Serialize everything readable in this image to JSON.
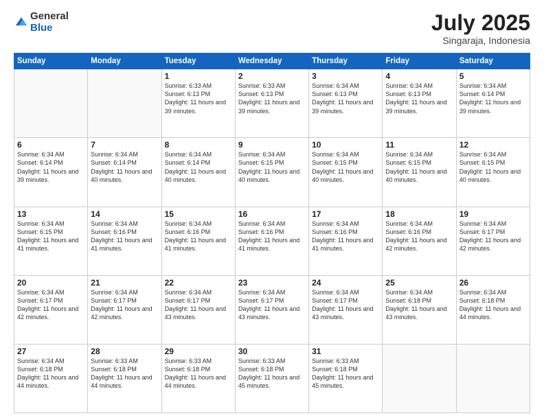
{
  "header": {
    "logo_general": "General",
    "logo_blue": "Blue",
    "month_year": "July 2025",
    "location": "Singaraja, Indonesia"
  },
  "days_of_week": [
    "Sunday",
    "Monday",
    "Tuesday",
    "Wednesday",
    "Thursday",
    "Friday",
    "Saturday"
  ],
  "weeks": [
    [
      {
        "day": "",
        "detail": ""
      },
      {
        "day": "",
        "detail": ""
      },
      {
        "day": "1",
        "detail": "Sunrise: 6:33 AM\nSunset: 6:13 PM\nDaylight: 11 hours\nand 39 minutes."
      },
      {
        "day": "2",
        "detail": "Sunrise: 6:33 AM\nSunset: 6:13 PM\nDaylight: 11 hours\nand 39 minutes."
      },
      {
        "day": "3",
        "detail": "Sunrise: 6:34 AM\nSunset: 6:13 PM\nDaylight: 11 hours\nand 39 minutes."
      },
      {
        "day": "4",
        "detail": "Sunrise: 6:34 AM\nSunset: 6:13 PM\nDaylight: 11 hours\nand 39 minutes."
      },
      {
        "day": "5",
        "detail": "Sunrise: 6:34 AM\nSunset: 6:14 PM\nDaylight: 11 hours\nand 39 minutes."
      }
    ],
    [
      {
        "day": "6",
        "detail": "Sunrise: 6:34 AM\nSunset: 6:14 PM\nDaylight: 11 hours\nand 39 minutes."
      },
      {
        "day": "7",
        "detail": "Sunrise: 6:34 AM\nSunset: 6:14 PM\nDaylight: 11 hours\nand 40 minutes."
      },
      {
        "day": "8",
        "detail": "Sunrise: 6:34 AM\nSunset: 6:14 PM\nDaylight: 11 hours\nand 40 minutes."
      },
      {
        "day": "9",
        "detail": "Sunrise: 6:34 AM\nSunset: 6:15 PM\nDaylight: 11 hours\nand 40 minutes."
      },
      {
        "day": "10",
        "detail": "Sunrise: 6:34 AM\nSunset: 6:15 PM\nDaylight: 11 hours\nand 40 minutes."
      },
      {
        "day": "11",
        "detail": "Sunrise: 6:34 AM\nSunset: 6:15 PM\nDaylight: 11 hours\nand 40 minutes."
      },
      {
        "day": "12",
        "detail": "Sunrise: 6:34 AM\nSunset: 6:15 PM\nDaylight: 11 hours\nand 40 minutes."
      }
    ],
    [
      {
        "day": "13",
        "detail": "Sunrise: 6:34 AM\nSunset: 6:15 PM\nDaylight: 11 hours\nand 41 minutes."
      },
      {
        "day": "14",
        "detail": "Sunrise: 6:34 AM\nSunset: 6:16 PM\nDaylight: 11 hours\nand 41 minutes."
      },
      {
        "day": "15",
        "detail": "Sunrise: 6:34 AM\nSunset: 6:16 PM\nDaylight: 11 hours\nand 41 minutes."
      },
      {
        "day": "16",
        "detail": "Sunrise: 6:34 AM\nSunset: 6:16 PM\nDaylight: 11 hours\nand 41 minutes."
      },
      {
        "day": "17",
        "detail": "Sunrise: 6:34 AM\nSunset: 6:16 PM\nDaylight: 11 hours\nand 41 minutes."
      },
      {
        "day": "18",
        "detail": "Sunrise: 6:34 AM\nSunset: 6:16 PM\nDaylight: 11 hours\nand 42 minutes."
      },
      {
        "day": "19",
        "detail": "Sunrise: 6:34 AM\nSunset: 6:17 PM\nDaylight: 11 hours\nand 42 minutes."
      }
    ],
    [
      {
        "day": "20",
        "detail": "Sunrise: 6:34 AM\nSunset: 6:17 PM\nDaylight: 11 hours\nand 42 minutes."
      },
      {
        "day": "21",
        "detail": "Sunrise: 6:34 AM\nSunset: 6:17 PM\nDaylight: 11 hours\nand 42 minutes."
      },
      {
        "day": "22",
        "detail": "Sunrise: 6:34 AM\nSunset: 6:17 PM\nDaylight: 11 hours\nand 43 minutes."
      },
      {
        "day": "23",
        "detail": "Sunrise: 6:34 AM\nSunset: 6:17 PM\nDaylight: 11 hours\nand 43 minutes."
      },
      {
        "day": "24",
        "detail": "Sunrise: 6:34 AM\nSunset: 6:17 PM\nDaylight: 11 hours\nand 43 minutes."
      },
      {
        "day": "25",
        "detail": "Sunrise: 6:34 AM\nSunset: 6:18 PM\nDaylight: 11 hours\nand 43 minutes."
      },
      {
        "day": "26",
        "detail": "Sunrise: 6:34 AM\nSunset: 6:18 PM\nDaylight: 11 hours\nand 44 minutes."
      }
    ],
    [
      {
        "day": "27",
        "detail": "Sunrise: 6:34 AM\nSunset: 6:18 PM\nDaylight: 11 hours\nand 44 minutes."
      },
      {
        "day": "28",
        "detail": "Sunrise: 6:33 AM\nSunset: 6:18 PM\nDaylight: 11 hours\nand 44 minutes."
      },
      {
        "day": "29",
        "detail": "Sunrise: 6:33 AM\nSunset: 6:18 PM\nDaylight: 11 hours\nand 44 minutes."
      },
      {
        "day": "30",
        "detail": "Sunrise: 6:33 AM\nSunset: 6:18 PM\nDaylight: 11 hours\nand 45 minutes."
      },
      {
        "day": "31",
        "detail": "Sunrise: 6:33 AM\nSunset: 6:18 PM\nDaylight: 11 hours\nand 45 minutes."
      },
      {
        "day": "",
        "detail": ""
      },
      {
        "day": "",
        "detail": ""
      }
    ]
  ]
}
